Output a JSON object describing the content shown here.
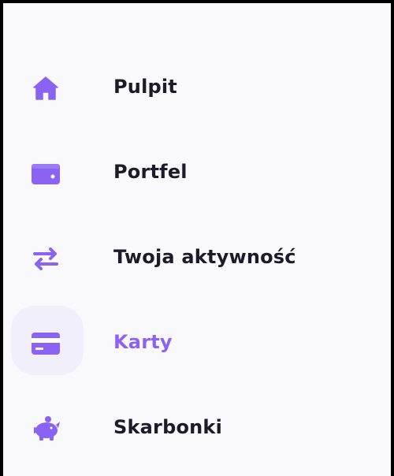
{
  "colors": {
    "accent": "#8a63f2",
    "text": "#1d1b28",
    "background": "#f9f9fc",
    "active_background": "#f1effb"
  },
  "sidebar": {
    "items": [
      {
        "label": "Pulpit",
        "icon": "home-icon",
        "active": false
      },
      {
        "label": "Portfel",
        "icon": "wallet-icon",
        "active": false
      },
      {
        "label": "Twoja aktywność",
        "icon": "transfer-arrows-icon",
        "active": false
      },
      {
        "label": "Karty",
        "icon": "credit-card-icon",
        "active": true
      },
      {
        "label": "Skarbonki",
        "icon": "piggy-bank-icon",
        "active": false
      }
    ]
  }
}
